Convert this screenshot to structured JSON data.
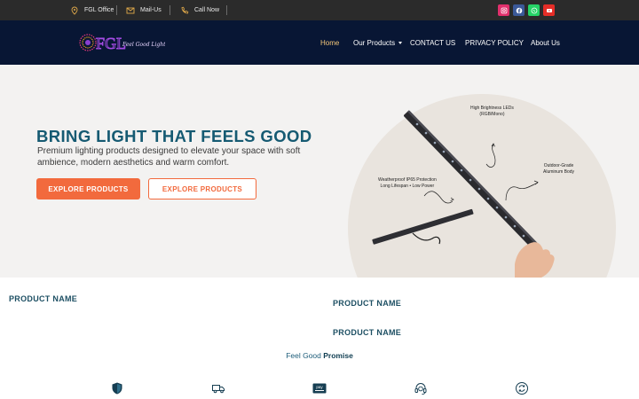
{
  "topbar": {
    "office": "FGL Office",
    "mail": "Mail-Us",
    "call": "Call Now",
    "social": [
      {
        "name": "instagram",
        "color": "#e1306c"
      },
      {
        "name": "facebook",
        "color": "#3b5998"
      },
      {
        "name": "whatsapp",
        "color": "#25d366"
      },
      {
        "name": "youtube",
        "color": "#e52d27"
      }
    ]
  },
  "header": {
    "logo_mark": "FGL",
    "logo_script": "Feel Good Lighting",
    "nav": {
      "home": "Home",
      "products": "Our Products",
      "contact": "CONTACT US",
      "privacy": "PRIVACY POLICY",
      "about": "About Us"
    }
  },
  "hero": {
    "title": "BRING LIGHT THAT FEELS GOOD",
    "subtitle": "Premium lighting products designed to elevate your space with soft ambience, modern aesthetics and warm comfort.",
    "btn_primary": "EXPLORE PRODUCTS",
    "btn_secondary": "EXPLORE PRODUCTS",
    "callouts": {
      "brightness": "High Brightness LEDs\n(RGB/Mono)",
      "body": "Outdoor-Grade\nAluminum Body",
      "weather": "Weatherproof IP65 Protection\nLong Lifespan • Low Power"
    },
    "accent": "#f26a3d",
    "title_color": "#155a72"
  },
  "products": {
    "left": "PRODUCT NAME",
    "right1": "PRODUCT NAME",
    "right2": "PRODUCT NAME"
  },
  "promise": {
    "prefix": "Feel Good",
    "emphasis": "Promise"
  },
  "features": [
    {
      "icon": "shield-icon"
    },
    {
      "icon": "delivery-truck-icon"
    },
    {
      "icon": "pay-card-icon"
    },
    {
      "icon": "support-headset-icon"
    },
    {
      "icon": "return-cycle-icon"
    }
  ]
}
